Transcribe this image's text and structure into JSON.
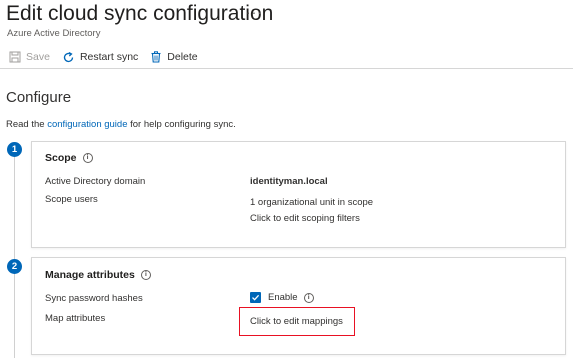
{
  "header": {
    "title": "Edit cloud sync configuration",
    "more": "···",
    "subtitle": "Azure Active Directory"
  },
  "toolbar": {
    "save_label": "Save",
    "restart_label": "Restart sync",
    "delete_label": "Delete"
  },
  "configure": {
    "heading": "Configure",
    "read_prefix": "Read the ",
    "guide_link": "configuration guide",
    "read_suffix": " for help configuring sync."
  },
  "scope": {
    "step": "1",
    "title": "Scope",
    "domain_label": "Active Directory domain",
    "domain_value": "identityman.local",
    "users_label": "Scope users",
    "users_value": "1 organizational unit in scope",
    "edit_filters_link": "Click to edit scoping filters"
  },
  "attributes": {
    "step": "2",
    "title": "Manage attributes",
    "password_label": "Sync password hashes",
    "enable_label": "Enable",
    "enable_checked": true,
    "map_label": "Map attributes",
    "edit_mappings_link": "Click to edit mappings"
  },
  "colors": {
    "accent": "#0067b8",
    "highlight": "#e81123"
  },
  "icons": [
    "save-icon",
    "restart-icon",
    "delete-icon",
    "info-icon",
    "checkmark-icon"
  ]
}
